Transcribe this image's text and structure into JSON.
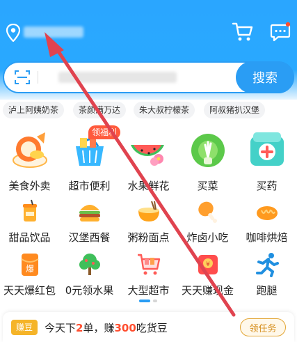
{
  "header": {
    "location_icon": "location-pin-icon",
    "cart_icon": "shopping-cart-icon",
    "message_icon": "message-bubble-icon"
  },
  "search": {
    "placeholder": "",
    "button_label": "搜索",
    "scan_icon": "scan-icon"
  },
  "chips": [
    "泸上阿姨奶茶",
    "茶颜满万达",
    "朱大叔柠檬茶",
    "阿叔猪扒汉堡"
  ],
  "categories_row1": [
    {
      "label": "美食外卖",
      "icon": "food-delivery-icon"
    },
    {
      "label": "超市便利",
      "icon": "supermarket-basket-icon",
      "badge": "领福利"
    },
    {
      "label": "水果鲜花",
      "icon": "watermelon-flower-icon"
    },
    {
      "label": "买菜",
      "icon": "vegetable-icon"
    },
    {
      "label": "买药",
      "icon": "medicine-box-icon"
    }
  ],
  "categories_row2": [
    {
      "label": "甜品饮品",
      "icon": "drink-cup-icon"
    },
    {
      "label": "汉堡西餐",
      "icon": "burger-icon"
    },
    {
      "label": "粥粉面点",
      "icon": "noodle-bowl-icon"
    },
    {
      "label": "炸卤小吃",
      "icon": "drumstick-icon"
    },
    {
      "label": "咖啡烘焙",
      "icon": "bread-icon"
    }
  ],
  "categories_row3": [
    {
      "label": "天天爆红包",
      "icon": "red-packet-icon"
    },
    {
      "label": "0元领水果",
      "icon": "fruit-tree-icon"
    },
    {
      "label": "大型超市",
      "icon": "shopping-cart-icon"
    },
    {
      "label": "天天赚现金",
      "icon": "cash-envelope-icon"
    },
    {
      "label": "跑腿",
      "icon": "running-man-icon"
    }
  ],
  "promo": {
    "tag": "赚豆",
    "text_pre": "今天下",
    "count": "2",
    "text_mid": "单，赚",
    "beans": "300",
    "text_post": "吃货豆",
    "button_label": "领任务"
  },
  "colors": {
    "brand_blue": "#2a9df4",
    "header_blue": "#29a9ff",
    "badge_red": "#ff5a3c",
    "highlight_red": "#ff4d2e",
    "bean_gold": "#f5b429",
    "annotation_red": "#e0434f"
  }
}
